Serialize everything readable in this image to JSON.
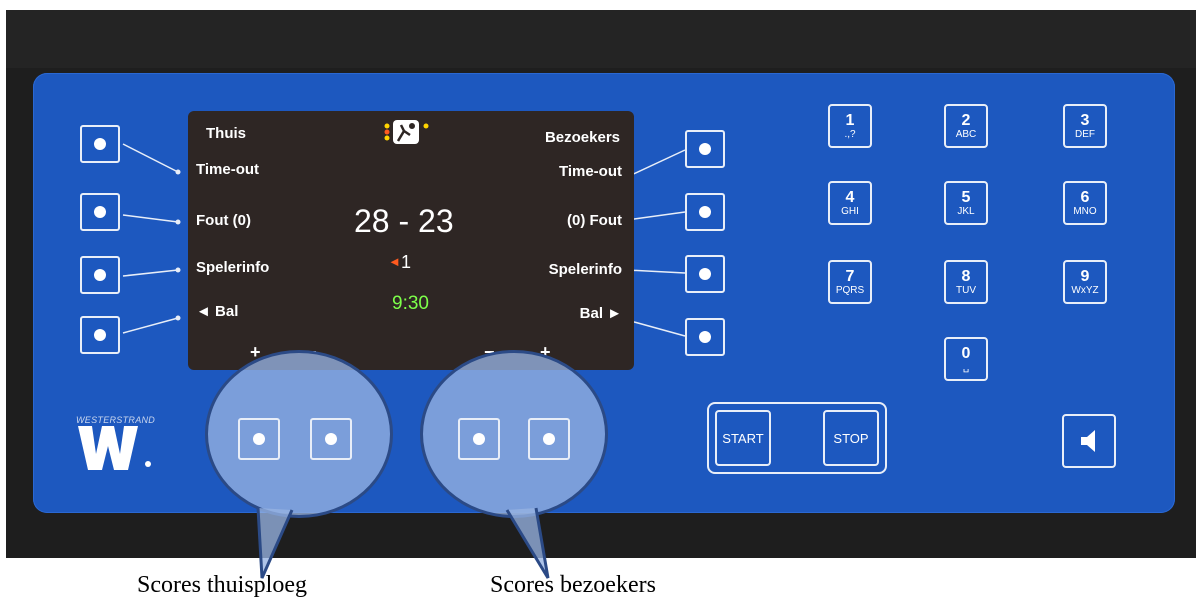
{
  "screen": {
    "home_label": "Thuis",
    "away_label": "Bezoekers",
    "left_timeout": "Time-out",
    "right_timeout": "Time-out",
    "left_foul": "Fout (0)",
    "right_foul": "(0) Fout",
    "left_playerinfo": "Spelerinfo",
    "right_playerinfo": "Spelerinfo",
    "left_ball": "◄ Bal",
    "right_ball": "Bal ►",
    "score": "28 - 23",
    "period": "1",
    "period_arrow": "◄",
    "clock": "9:30",
    "home_plus": "+",
    "home_minus": "−",
    "away_minus": "−",
    "away_plus": "+"
  },
  "keypad": [
    {
      "num": "1",
      "letters": ".,?"
    },
    {
      "num": "2",
      "letters": "ABC"
    },
    {
      "num": "3",
      "letters": "DEF"
    },
    {
      "num": "4",
      "letters": "GHI"
    },
    {
      "num": "5",
      "letters": "JKL"
    },
    {
      "num": "6",
      "letters": "MNO"
    },
    {
      "num": "7",
      "letters": "PQRS"
    },
    {
      "num": "8",
      "letters": "TUV"
    },
    {
      "num": "9",
      "letters": "WxYZ"
    },
    {
      "num": "0",
      "letters": "␣"
    }
  ],
  "controls": {
    "start_label": "START",
    "stop_label": "STOP"
  },
  "brand": {
    "name": "WESTERSTRAND",
    "logo_letter": "W"
  },
  "captions": {
    "home": "Scores thuisploeg",
    "away": "Scores bezoekers"
  },
  "colors": {
    "panel": "#1d58bf",
    "screen": "#2e2624",
    "clock": "#7dff4a",
    "arrow": "#ff5a1f"
  },
  "icons": {
    "speaker": "speaker-icon",
    "sport": "handball-icon"
  }
}
